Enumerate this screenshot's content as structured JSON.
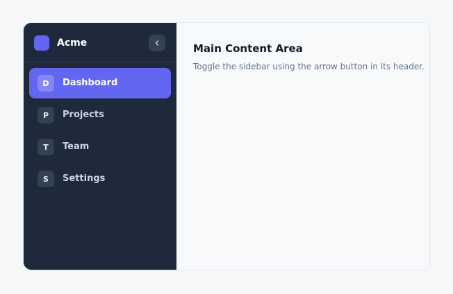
{
  "sidebar": {
    "brand": "Acme",
    "collapse_icon": "chevron-left-icon",
    "items": [
      {
        "badge": "D",
        "label": "Dashboard",
        "active": true
      },
      {
        "badge": "P",
        "label": "Projects",
        "active": false
      },
      {
        "badge": "T",
        "label": "Team",
        "active": false
      },
      {
        "badge": "S",
        "label": "Settings",
        "active": false
      }
    ]
  },
  "main": {
    "title": "Main Content Area",
    "description": "Toggle the sidebar using the arrow button in its header."
  },
  "colors": {
    "sidebar_bg": "#1e293b",
    "accent": "#6366f1",
    "page_bg": "#f6f7f9"
  }
}
